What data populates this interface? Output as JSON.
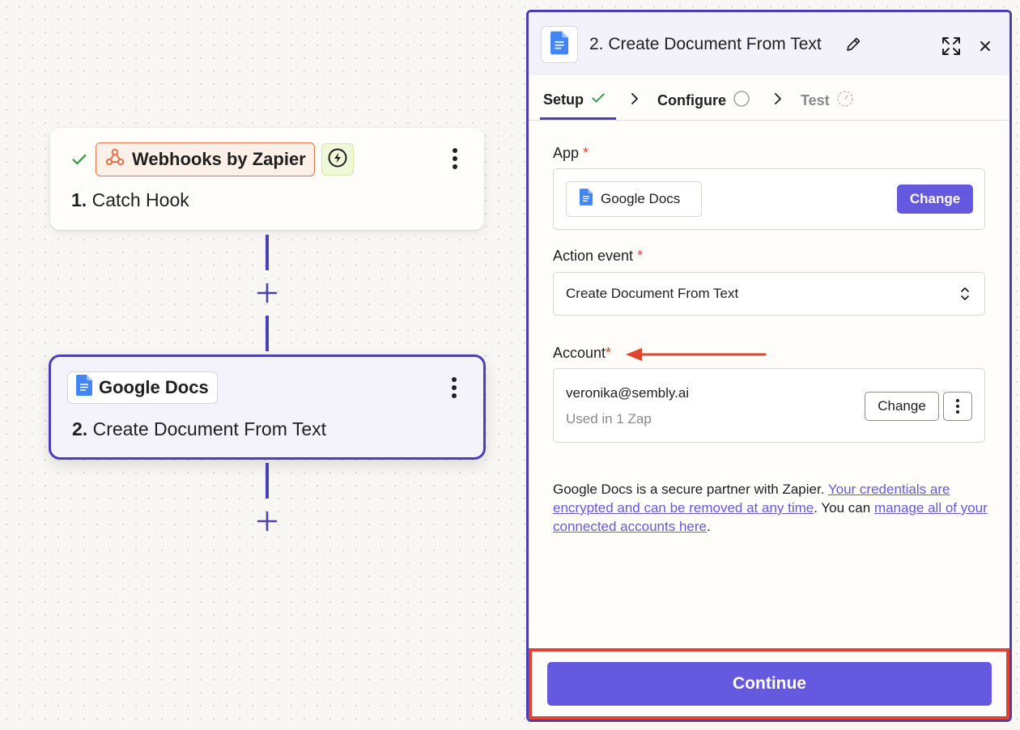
{
  "canvas": {
    "step1": {
      "app_name": "Webhooks by Zapier",
      "number": "1.",
      "title": "Catch Hook",
      "status": "complete",
      "trigger_type": "instant"
    },
    "step2": {
      "app_name": "Google Docs",
      "number": "2.",
      "title": "Create Document From Text"
    }
  },
  "panel": {
    "title": "2. Create Document From Text",
    "tabs": [
      {
        "label": "Setup",
        "status": "complete"
      },
      {
        "label": "Configure",
        "status": "incomplete"
      },
      {
        "label": "Test",
        "status": "disabled"
      }
    ],
    "app_field": {
      "label": "App",
      "required_mark": "*",
      "value": "Google Docs",
      "change_label": "Change"
    },
    "action_event": {
      "label": "Action event",
      "required_mark": "*",
      "value": "Create Document From Text"
    },
    "account": {
      "label": "Account",
      "required_mark": "*",
      "email": "veronika@sembly.ai",
      "usage": "Used in 1 Zap",
      "change_label": "Change"
    },
    "partner_note": {
      "prefix": "Google Docs is a secure partner with Zapier. ",
      "link1": "Your credentials are encrypted and can be removed at any time",
      "middle": ". You can ",
      "link2": "manage all of your connected accounts here",
      "suffix": "."
    },
    "continue_label": "Continue"
  },
  "colors": {
    "accent": "#6559e0",
    "selected_border": "#4b3fb5",
    "required": "#e0452f",
    "highlight": "#e0452f",
    "success": "#3c9a4b",
    "webhooks_orange": "#e8734a",
    "docs_blue": "#4285f4"
  }
}
